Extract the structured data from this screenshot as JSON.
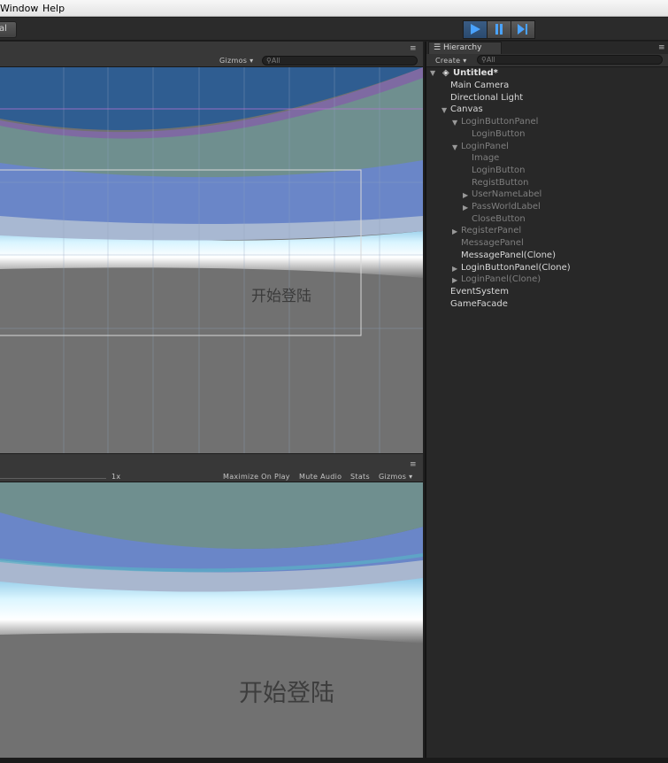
{
  "menubar": {
    "items": [
      "Window",
      "Help"
    ]
  },
  "toolbar": {
    "left_button_partial": "al"
  },
  "scene": {
    "gizmos_label": "Gizmos",
    "search_placeholder": "All",
    "canvas_text": "开始登陆",
    "menu_icon": "≡"
  },
  "game": {
    "scale_label": "1x",
    "buttons": [
      "Maximize On Play",
      "Mute Audio",
      "Stats",
      "Gizmos"
    ],
    "canvas_text": "开始登陆",
    "menu_icon": "≡"
  },
  "hierarchy": {
    "tab_label": "Hierarchy",
    "create_label": "Create",
    "search_placeholder": "All",
    "scene_name": "Untitled*",
    "items": [
      {
        "label": "Main Camera",
        "depth": 1,
        "arrow": "",
        "state": "active"
      },
      {
        "label": "Directional Light",
        "depth": 1,
        "arrow": "",
        "state": "active"
      },
      {
        "label": "Canvas",
        "depth": 1,
        "arrow": "expanded",
        "state": "active"
      },
      {
        "label": "LoginButtonPanel",
        "depth": 2,
        "arrow": "expanded",
        "state": "inactive"
      },
      {
        "label": "LoginButton",
        "depth": 3,
        "arrow": "",
        "state": "inactive"
      },
      {
        "label": "LoginPanel",
        "depth": 2,
        "arrow": "expanded",
        "state": "inactive"
      },
      {
        "label": "Image",
        "depth": 3,
        "arrow": "",
        "state": "inactive"
      },
      {
        "label": "LoginButton",
        "depth": 3,
        "arrow": "",
        "state": "inactive"
      },
      {
        "label": "RegistButton",
        "depth": 3,
        "arrow": "",
        "state": "inactive"
      },
      {
        "label": "UserNameLabel",
        "depth": 3,
        "arrow": "collapsed",
        "state": "inactive"
      },
      {
        "label": "PassWorldLabel",
        "depth": 3,
        "arrow": "collapsed",
        "state": "inactive"
      },
      {
        "label": "CloseButton",
        "depth": 3,
        "arrow": "",
        "state": "inactive"
      },
      {
        "label": "RegisterPanel",
        "depth": 2,
        "arrow": "collapsed",
        "state": "inactive"
      },
      {
        "label": "MessagePanel",
        "depth": 2,
        "arrow": "",
        "state": "inactive"
      },
      {
        "label": "MessagePanel(Clone)",
        "depth": 2,
        "arrow": "",
        "state": "active"
      },
      {
        "label": "LoginButtonPanel(Clone)",
        "depth": 2,
        "arrow": "collapsed",
        "state": "active"
      },
      {
        "label": "LoginPanel(Clone)",
        "depth": 2,
        "arrow": "collapsed",
        "state": "inactive"
      },
      {
        "label": "EventSystem",
        "depth": 1,
        "arrow": "",
        "state": "active"
      },
      {
        "label": "GameFacade",
        "depth": 1,
        "arrow": "",
        "state": "active"
      }
    ]
  },
  "colors": {
    "active_text": "#d8d8d8",
    "inactive_text": "#7f7f7f",
    "play_blue": "#4aa3ff",
    "panel_bg": "#282828"
  }
}
